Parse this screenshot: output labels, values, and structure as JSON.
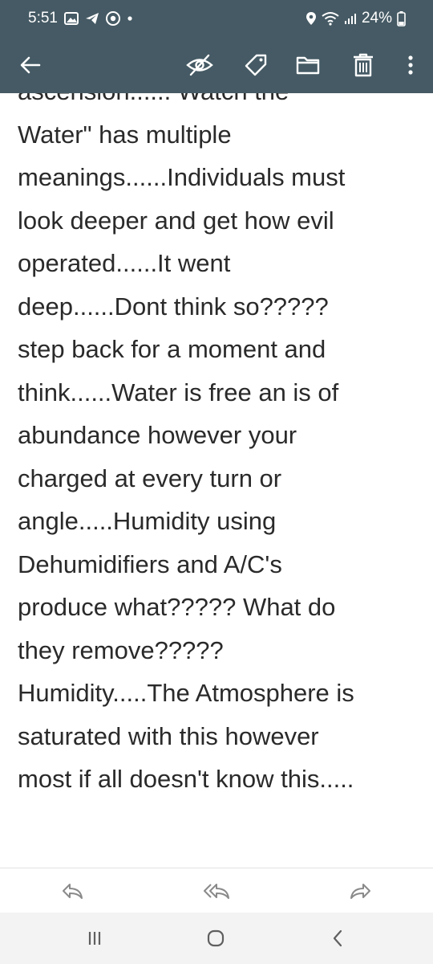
{
  "status_bar": {
    "time": "5:51",
    "battery": "24%",
    "icons": [
      "gallery-icon",
      "telegram-icon",
      "chrome-icon",
      "notification-dot",
      "location-icon",
      "wifi-icon",
      "signal-icon",
      "battery-icon"
    ]
  },
  "toolbar": {
    "background": "#455a64",
    "icons": [
      "back-arrow-icon",
      "hide-eye-icon",
      "tag-icon",
      "folder-icon",
      "trash-icon",
      "more-vert-icon"
    ]
  },
  "note": {
    "text": "ascension...... Watch the\nWater\" has multiple\nmeanings......Individuals must\nlook deeper and get how evil\noperated......It went\ndeep......Dont think so?????\nstep back for a moment and\nthink......Water is free an is of\nabundance however your\ncharged at every turn or\nangle.....Humidity using\nDehumidifiers and A/C's\nproduce what????? What do\nthey remove?????\nHumidity.....The Atmosphere is\nsaturated with this however\nmost if all doesn't know this....."
  },
  "action_bar": {
    "icons": [
      "reply-icon",
      "reply-all-icon",
      "forward-icon"
    ]
  },
  "nav_bar": {
    "icons": [
      "recents-icon",
      "home-icon",
      "back-icon"
    ]
  }
}
